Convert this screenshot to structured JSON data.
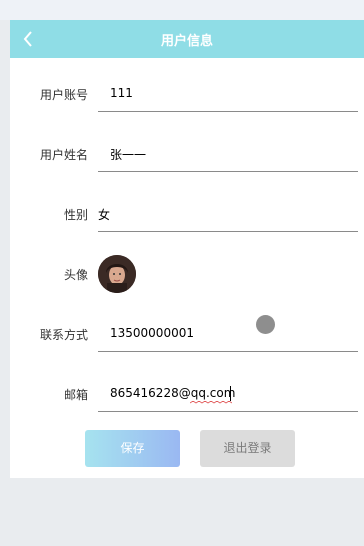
{
  "header": {
    "title": "用户信息"
  },
  "form": {
    "fields": [
      {
        "label": "用户账号",
        "value": "111"
      },
      {
        "label": "用户姓名",
        "value": "张一一"
      },
      {
        "label": "性别",
        "value": "女"
      },
      {
        "label": "头像",
        "value": ""
      },
      {
        "label": "联系方式",
        "value": "13500000001"
      },
      {
        "label": "邮箱",
        "value": "865416228@qq.com"
      }
    ]
  },
  "actions": {
    "save_label": "保存",
    "logout_label": "退出登录"
  },
  "colors": {
    "header_bg": "#8fdde6",
    "save_gradient_start": "#a6e3ef",
    "save_gradient_end": "#9ab8f2",
    "logout_bg": "#dcdcdc"
  },
  "icons": {
    "back": "chevron-left-icon",
    "avatar": "user-avatar-photo"
  }
}
